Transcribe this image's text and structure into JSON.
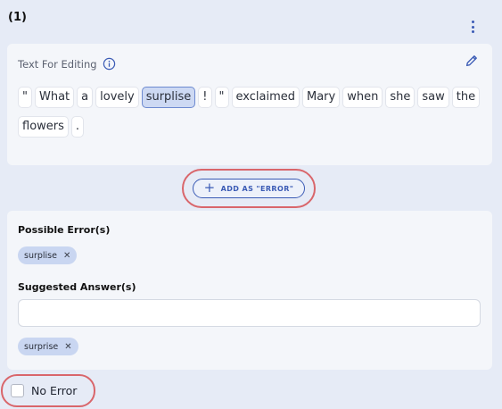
{
  "question": {
    "number": "(1)"
  },
  "editor": {
    "title": "Text For Editing",
    "tokens": [
      {
        "text": "\"",
        "selected": false
      },
      {
        "text": "What",
        "selected": false
      },
      {
        "text": "a",
        "selected": false
      },
      {
        "text": "lovely",
        "selected": false
      },
      {
        "text": "surplise",
        "selected": true
      },
      {
        "text": "!",
        "selected": false
      },
      {
        "text": "\"",
        "selected": false
      },
      {
        "text": "exclaimed",
        "selected": false
      },
      {
        "text": "Mary",
        "selected": false
      },
      {
        "text": "when",
        "selected": false
      },
      {
        "text": "she",
        "selected": false
      },
      {
        "text": "saw",
        "selected": false
      },
      {
        "text": "the",
        "selected": false
      },
      {
        "text": "flowers",
        "selected": false
      },
      {
        "text": ".",
        "selected": false
      }
    ]
  },
  "actions": {
    "add_error_label": "ADD AS \"ERROR\""
  },
  "answer": {
    "possible_errors_label": "Possible Error(s)",
    "possible_error_chip": "surplise",
    "suggested_answers_label": "Suggested Answer(s)",
    "suggested_input_value": "",
    "suggested_input_placeholder": "",
    "suggested_answer_chip": "surprise"
  },
  "no_error": {
    "label": "No Error",
    "checked": false
  },
  "colors": {
    "accent": "#3b5bb5",
    "highlight_ring": "#d9666b",
    "selected_token": "#cdd9f3",
    "chip": "#c9d6f1"
  }
}
